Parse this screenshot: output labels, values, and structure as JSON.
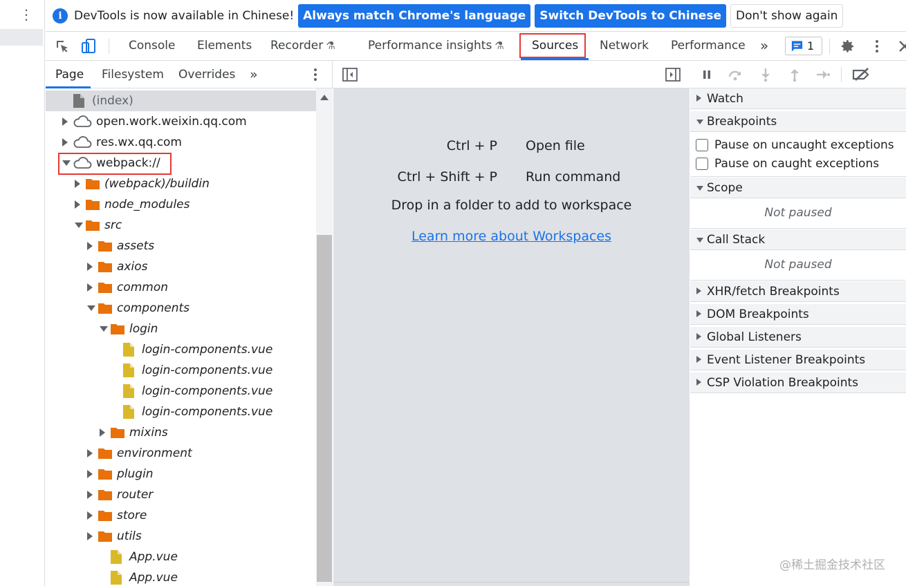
{
  "infobar": {
    "message": "DevTools is now available in Chinese!",
    "always_match_label": "Always match Chrome's language",
    "switch_label": "Switch DevTools to Chinese",
    "dont_show_label": "Don't show again"
  },
  "tabs": {
    "console": "Console",
    "elements": "Elements",
    "recorder": "Recorder",
    "performance_insights": "Performance insights",
    "sources": "Sources",
    "network": "Network",
    "performance": "Performance",
    "more": "»",
    "issues_count": "1"
  },
  "navigator": {
    "tabs": {
      "page": "Page",
      "filesystem": "Filesystem",
      "overrides": "Overrides",
      "more": "»"
    },
    "tree": [
      {
        "label": "(index)",
        "kind": "file-gray",
        "level": 0,
        "toggle": "none",
        "selected": true
      },
      {
        "label": "open.work.weixin.qq.com",
        "kind": "cloud",
        "level": 0,
        "toggle": "collapsed"
      },
      {
        "label": "res.wx.qq.com",
        "kind": "cloud",
        "level": 0,
        "toggle": "collapsed"
      },
      {
        "label": "webpack://",
        "kind": "cloud",
        "level": 0,
        "toggle": "expanded"
      },
      {
        "label": "(webpack)/buildin",
        "kind": "folder",
        "level": 1,
        "toggle": "collapsed"
      },
      {
        "label": "node_modules",
        "kind": "folder",
        "level": 1,
        "toggle": "collapsed"
      },
      {
        "label": "src",
        "kind": "folder",
        "level": 1,
        "toggle": "expanded"
      },
      {
        "label": "assets",
        "kind": "folder",
        "level": 2,
        "toggle": "collapsed"
      },
      {
        "label": "axios",
        "kind": "folder",
        "level": 2,
        "toggle": "collapsed"
      },
      {
        "label": "common",
        "kind": "folder",
        "level": 2,
        "toggle": "collapsed"
      },
      {
        "label": "components",
        "kind": "folder",
        "level": 2,
        "toggle": "expanded"
      },
      {
        "label": "login",
        "kind": "folder",
        "level": 3,
        "toggle": "expanded"
      },
      {
        "label": "login-components.vue",
        "kind": "file",
        "level": 4,
        "toggle": "none"
      },
      {
        "label": "login-components.vue",
        "kind": "file",
        "level": 4,
        "toggle": "none"
      },
      {
        "label": "login-components.vue",
        "kind": "file",
        "level": 4,
        "toggle": "none"
      },
      {
        "label": "login-components.vue",
        "kind": "file",
        "level": 4,
        "toggle": "none"
      },
      {
        "label": "mixins",
        "kind": "folder",
        "level": 3,
        "toggle": "collapsed"
      },
      {
        "label": "environment",
        "kind": "folder",
        "level": 2,
        "toggle": "collapsed"
      },
      {
        "label": "plugin",
        "kind": "folder",
        "level": 2,
        "toggle": "collapsed"
      },
      {
        "label": "router",
        "kind": "folder",
        "level": 2,
        "toggle": "collapsed"
      },
      {
        "label": "store",
        "kind": "folder",
        "level": 2,
        "toggle": "collapsed"
      },
      {
        "label": "utils",
        "kind": "folder",
        "level": 2,
        "toggle": "collapsed"
      },
      {
        "label": "App.vue",
        "kind": "file",
        "level": 3,
        "toggle": "none"
      },
      {
        "label": "App.vue",
        "kind": "file",
        "level": 3,
        "toggle": "none"
      }
    ]
  },
  "editor": {
    "shortcuts": [
      {
        "keys": "Ctrl + P",
        "action": "Open file"
      },
      {
        "keys": "Ctrl + Shift + P",
        "action": "Run command"
      }
    ],
    "drop_text": "Drop in a folder to add to workspace",
    "learn_more": "Learn more about Workspaces"
  },
  "debugger": {
    "watch": "Watch",
    "breakpoints": "Breakpoints",
    "pause_uncaught": "Pause on uncaught exceptions",
    "pause_caught": "Pause on caught exceptions",
    "scope": "Scope",
    "scope_status": "Not paused",
    "call_stack": "Call Stack",
    "call_stack_status": "Not paused",
    "xhr": "XHR/fetch Breakpoints",
    "dom": "DOM Breakpoints",
    "global": "Global Listeners",
    "event_listener": "Event Listener Breakpoints",
    "csp": "CSP Violation Breakpoints"
  },
  "watermark": "@稀土掘金技术社区",
  "colors": {
    "accent": "#1a73e8",
    "highlight": "#e53935",
    "folder": "#e8710a",
    "file": "#d9b92a"
  }
}
